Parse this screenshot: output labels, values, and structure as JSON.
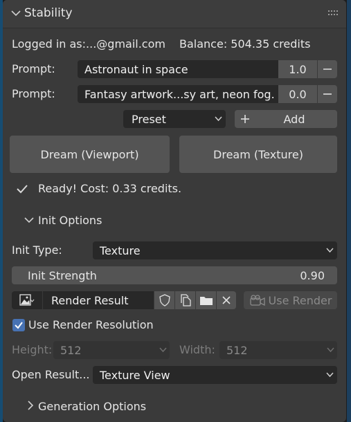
{
  "panel": {
    "title": "Stability"
  },
  "account": {
    "logged_in": "Logged in as:...@gmail.com",
    "balance": "Balance: 504.35 credits"
  },
  "prompts": [
    {
      "label": "Prompt:",
      "text": "Astronaut in space",
      "weight": "1.0"
    },
    {
      "label": "Prompt:",
      "text": "Fantasy artwork...sy art, neon fog.",
      "weight": "0.0"
    }
  ],
  "preset": {
    "value": "Preset",
    "add_label": "Add"
  },
  "dream": {
    "viewport_label": "Dream (Viewport)",
    "texture_label": "Dream (Texture)"
  },
  "status": {
    "text": "Ready! Cost: 0.33 credits."
  },
  "init_options": {
    "section_label": "Init Options",
    "type_label": "Init Type:",
    "type_value": "Texture",
    "strength_label": "Init Strength",
    "strength_value": "0.90"
  },
  "render": {
    "image_name": "Render Result",
    "use_render_label": "Use Render",
    "use_resolution_label": "Use Render Resolution",
    "use_resolution_checked": true
  },
  "resolution": {
    "height_label": "Height:",
    "height_value": "512",
    "width_label": "Width:",
    "width_value": "512"
  },
  "open_result": {
    "label": "Open Result...",
    "value": "Texture View"
  },
  "generation_options": {
    "section_label": "Generation Options"
  },
  "colors": {
    "accent": "#4772b3",
    "panel": "#3a3a3a",
    "field": "#282828",
    "button": "#545454"
  }
}
